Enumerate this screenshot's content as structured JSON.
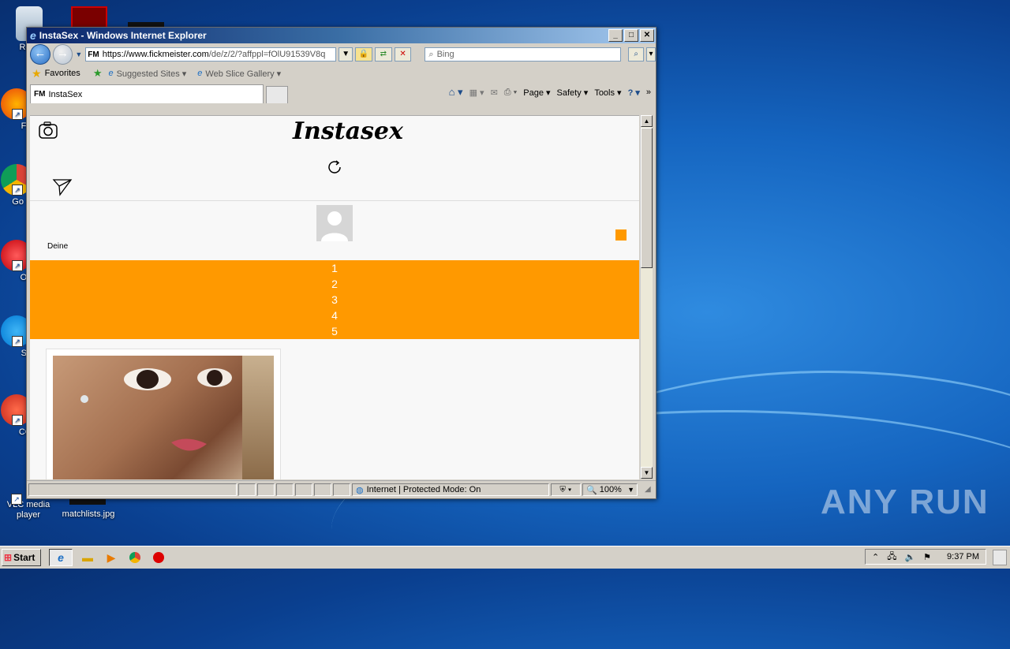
{
  "desktop": {
    "icons": [
      {
        "label": "Recy"
      },
      {
        "label": "Fir"
      },
      {
        "label": "Go Chr"
      },
      {
        "label": "Op"
      },
      {
        "label": "Sk"
      },
      {
        "label": "CCl"
      },
      {
        "label": "VLC media player"
      },
      {
        "label": "matchlists.jpg"
      }
    ],
    "watermark": "ANY RUN"
  },
  "window": {
    "title": "InstaSex - Windows Internet Explorer",
    "minimize": "_",
    "maximize": "□",
    "close": "✕"
  },
  "navbar": {
    "back": "←",
    "forward": "→",
    "address_favicon": "FM",
    "address_prefix": "https://www.",
    "address_domain": "fickmeister.com",
    "address_rest": "/de/z/2/?affppl=fOlU91539V8q",
    "search_placeholder": "Bing"
  },
  "favorites_bar": {
    "favorites": "Favorites",
    "suggested_sites": "Suggested Sites ▾",
    "web_slice_gallery": "Web Slice Gallery ▾"
  },
  "tabs": {
    "active_tab_favicon": "FM",
    "active_tab": "InstaSex"
  },
  "command_bar": {
    "page": "Page ▾",
    "safety": "Safety ▾",
    "tools": "Tools ▾",
    "more": "»"
  },
  "page": {
    "logo": "Instasex",
    "profile_label": "Deine",
    "menu_items": [
      "1",
      "2",
      "3",
      "4",
      "5"
    ]
  },
  "statusbar": {
    "zone": "Internet | Protected Mode: On",
    "zoom": "100%"
  },
  "taskbar": {
    "start": "Start",
    "clock": "9:37 PM"
  }
}
